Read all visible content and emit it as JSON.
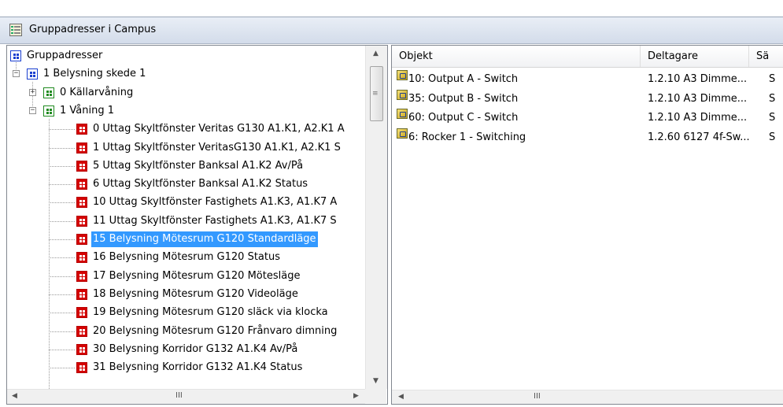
{
  "window": {
    "title": "Gruppadresser i Campus",
    "icon": "group-addresses-icon"
  },
  "tree": {
    "items": [
      {
        "label": "Gruppadresser",
        "level": 0,
        "icon": "blue",
        "expander": ""
      },
      {
        "label": "1 Belysning skede 1",
        "level": 1,
        "icon": "blue",
        "expander": "−"
      },
      {
        "label": "0 Källarvåning",
        "level": 2,
        "icon": "green",
        "expander": "+"
      },
      {
        "label": "1 Våning 1",
        "level": 2,
        "icon": "green",
        "expander": "−"
      },
      {
        "label": "0 Uttag Skyltfönster Veritas G130 A1.K1, A2.K1 A",
        "level": 3,
        "icon": "red"
      },
      {
        "label": "1 Uttag Skyltfönster VeritasG130 A1.K1, A2.K1 S",
        "level": 3,
        "icon": "red"
      },
      {
        "label": "5 Uttag Skyltfönster Banksal A1.K2 Av/På",
        "level": 3,
        "icon": "red"
      },
      {
        "label": "6 Uttag Skyltfönster Banksal A1.K2 Status",
        "level": 3,
        "icon": "red"
      },
      {
        "label": "10 Uttag Skyltfönster Fastighets A1.K3, A1.K7 A",
        "level": 3,
        "icon": "red"
      },
      {
        "label": "11 Uttag Skyltfönster Fastighets A1.K3, A1.K7 S",
        "level": 3,
        "icon": "red"
      },
      {
        "label": "15 Belysning Mötesrum G120 Standardläge",
        "level": 3,
        "icon": "red",
        "selected": true
      },
      {
        "label": "16 Belysning Mötesrum G120 Status",
        "level": 3,
        "icon": "red"
      },
      {
        "label": "17 Belysning Mötesrum G120 Mötesläge",
        "level": 3,
        "icon": "red"
      },
      {
        "label": "18 Belysning Mötesrum G120 Videoläge",
        "level": 3,
        "icon": "red"
      },
      {
        "label": "19 Belysning Mötesrum G120 släck via klocka",
        "level": 3,
        "icon": "red"
      },
      {
        "label": "20 Belysning Mötesrum G120 Frånvaro dimning",
        "level": 3,
        "icon": "red"
      },
      {
        "label": "30 Belysning Korridor G132 A1.K4 Av/På",
        "level": 3,
        "icon": "red"
      },
      {
        "label": "31 Belysning Korridor G132 A1.K4 Status",
        "level": 3,
        "icon": "red"
      }
    ]
  },
  "list": {
    "columns": [
      "Objekt",
      "Deltagare",
      "Sä"
    ],
    "rows": [
      {
        "objekt": "10: Output A - Switch",
        "deltagare": "1.2.10 A3 Dimme...",
        "s": "S"
      },
      {
        "objekt": "35: Output B - Switch",
        "deltagare": "1.2.10 A3 Dimme...",
        "s": "S"
      },
      {
        "objekt": "60: Output C - Switch",
        "deltagare": "1.2.10 A3 Dimme...",
        "s": "S"
      },
      {
        "objekt": "6: Rocker 1 - Switching",
        "deltagare": "1.2.60 6127 4f-Sw...",
        "s": "S"
      }
    ]
  },
  "scrollbar": {
    "grip": "≡",
    "hgrip": "III",
    "up": "▲",
    "down": "▼",
    "left": "◀",
    "right": "▶"
  },
  "colors": {
    "selection": "#3399ff",
    "title_bg": "#dbe3ef",
    "group_icon_blue": "#1a3fd0",
    "group_icon_green": "#1f8a1f",
    "address_icon_red": "#d40000"
  }
}
